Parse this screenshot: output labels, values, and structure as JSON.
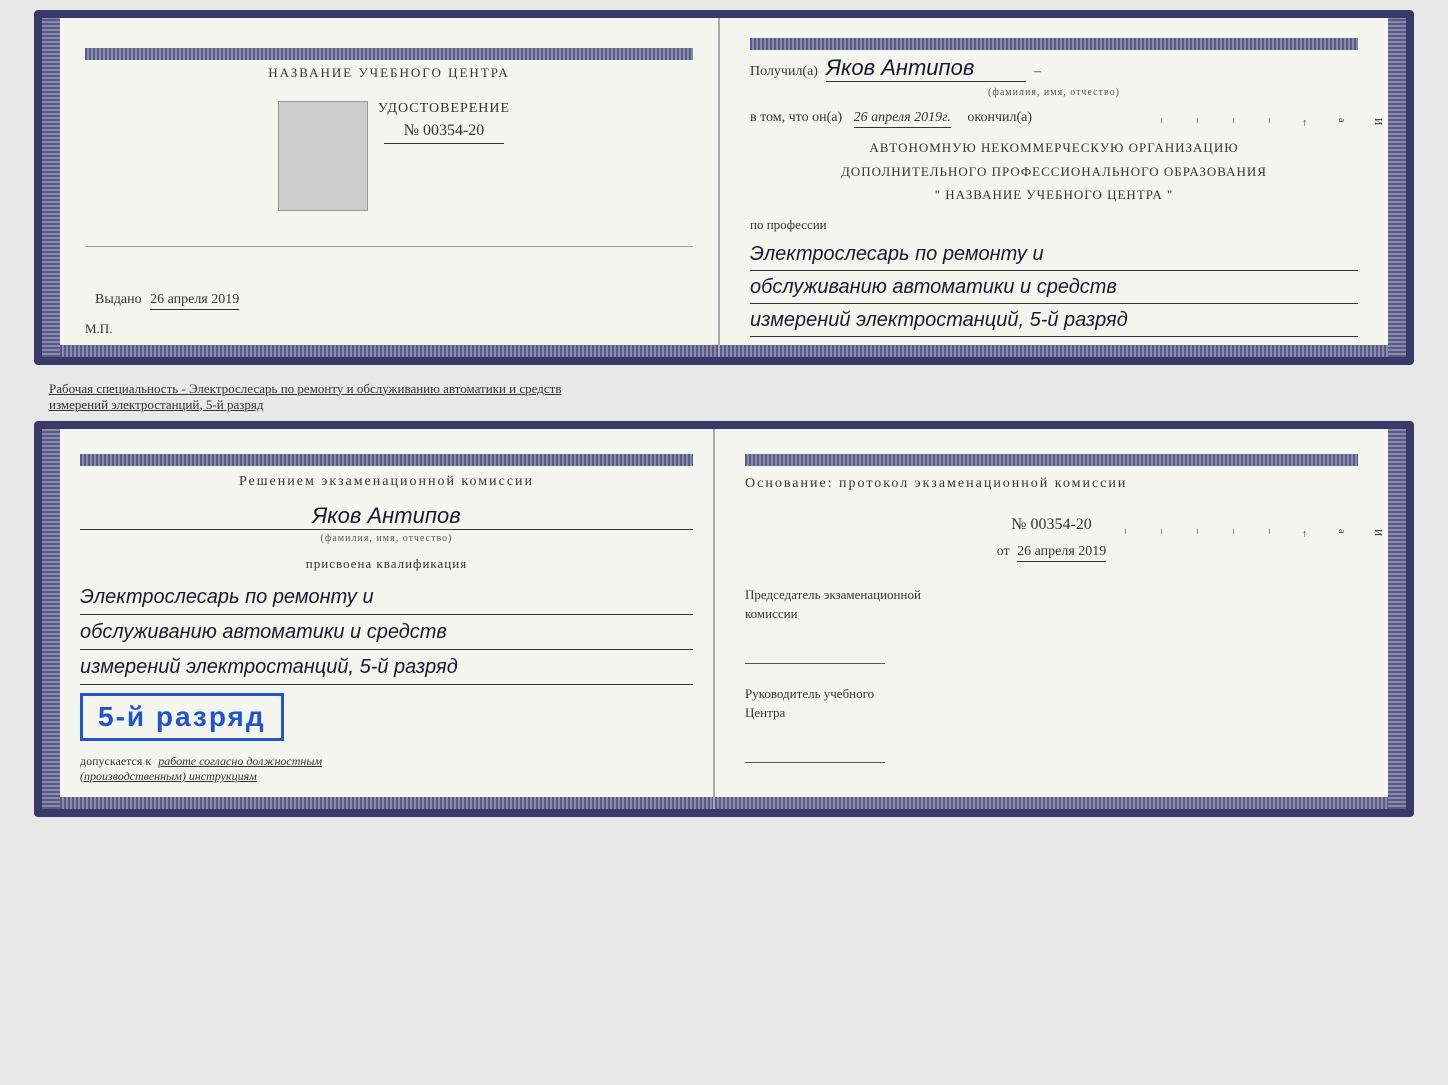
{
  "doc1": {
    "left": {
      "header": "НАЗВАНИЕ УЧЕБНОГО ЦЕНТРА",
      "cert_title": "УДОСТОВЕРЕНИЕ",
      "cert_number": "№ 00354-20",
      "issued_label": "Выдано",
      "issued_date": "26 апреля 2019",
      "mp": "М.П."
    },
    "right": {
      "received_label": "Получил(а)",
      "recipient_name": "Яков Антипов",
      "fio_sub": "(фамилия, имя, отчество)",
      "in_that_label": "в том, что он(а)",
      "date": "26 апреля 2019г.",
      "finished_label": "окончил(а)",
      "org_line1": "АВТОНОМНУЮ НЕКОММЕРЧЕСКУЮ ОРГАНИЗАЦИЮ",
      "org_line2": "ДОПОЛНИТЕЛЬНОГО ПРОФЕССИОНАЛЬНОГО ОБРАЗОВАНИЯ",
      "org_line3": "\" НАЗВАНИЕ УЧЕБНОГО ЦЕНТРА \"",
      "profession_label": "по профессии",
      "profession_line1": "Электрослесарь по ремонту и",
      "profession_line2": "обслуживанию автоматики и средств",
      "profession_line3": "измерений электростанций, 5-й разряд",
      "annotations": [
        "И",
        "а",
        "←",
        "–",
        "–",
        "–",
        "–"
      ]
    }
  },
  "between_text": "Рабочая специальность - Электрослесарь по ремонту и обслуживанию автоматики и средств\nизмерений электростанций, 5-й разряд",
  "doc2": {
    "left": {
      "commission_line1": "Решением  экзаменационной  комиссии",
      "person_name": "Яков Антипов",
      "fio_sub": "(фамилия, имя, отчество)",
      "qualification_label": "присвоена квалификация",
      "qual_line1": "Электрослесарь по ремонту и",
      "qual_line2": "обслуживанию автоматики и средств",
      "qual_line3": "измерений электростанций, 5-й разряд",
      "rank_badge": "5-й разряд",
      "allowed_prefix": "допускается к",
      "allowed_text": "работе согласно должностным",
      "allowed_text2": "(производственным) инструкциям"
    },
    "right": {
      "basis_label": "Основание:  протокол  экзаменационной  комиссии",
      "protocol_number": "№  00354-20",
      "from_label": "от",
      "from_date": "26 апреля 2019",
      "chairman_title": "Председатель экзаменационной\nкомиссии",
      "director_title": "Руководитель учебного\nЦентра",
      "annotations": [
        "И",
        "а",
        "←",
        "–",
        "–",
        "–",
        "–",
        "–"
      ]
    }
  }
}
